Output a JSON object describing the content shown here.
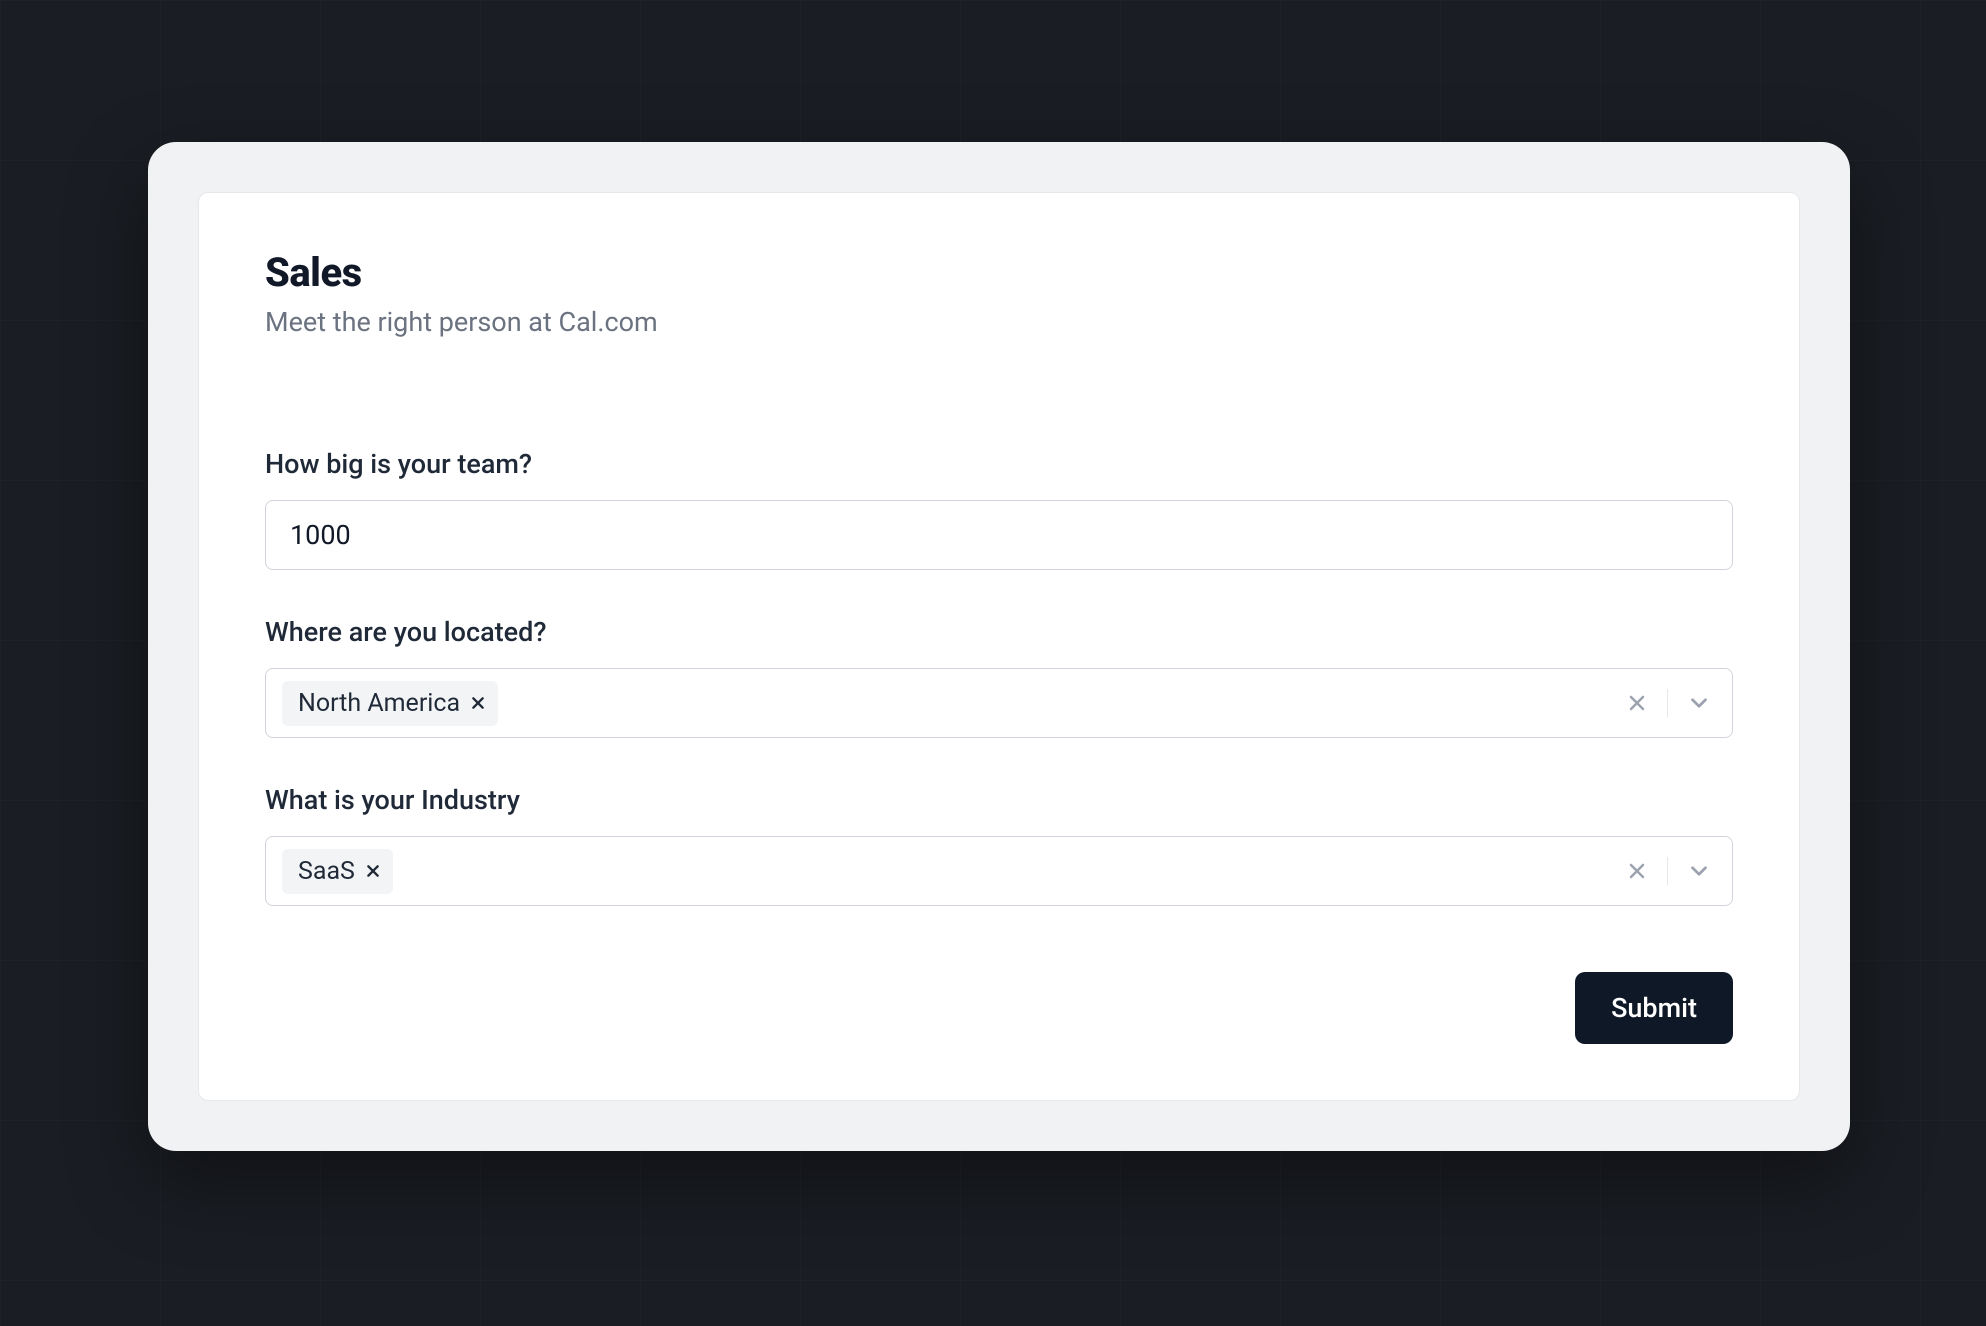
{
  "header": {
    "title": "Sales",
    "subtitle": "Meet the right person at Cal.com"
  },
  "form": {
    "team_size": {
      "label": "How big is your team?",
      "value": "1000"
    },
    "location": {
      "label": "Where are you located?",
      "selected": [
        {
          "label": "North America"
        }
      ]
    },
    "industry": {
      "label": "What is your Industry",
      "selected": [
        {
          "label": "SaaS"
        }
      ]
    },
    "submit_label": "Submit"
  },
  "icons": {
    "close": "close-icon",
    "chevron_down": "chevron-down-icon"
  }
}
